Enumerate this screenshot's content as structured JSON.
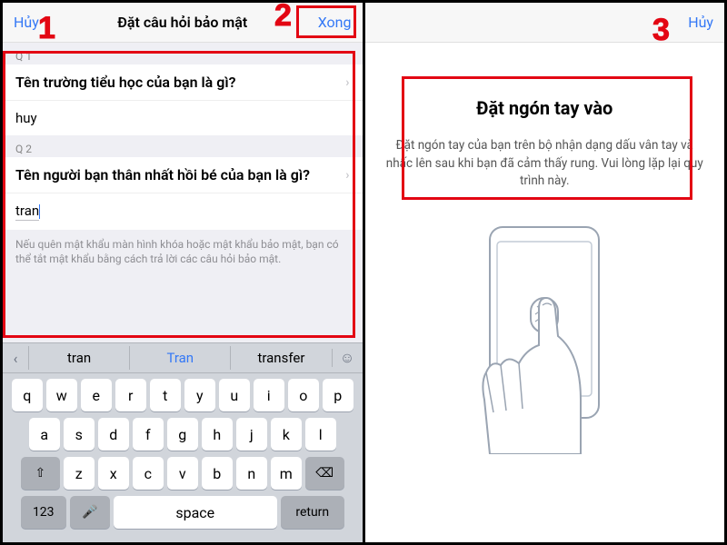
{
  "badges": {
    "n1": "1",
    "n2": "2",
    "n3": "3"
  },
  "left": {
    "nav": {
      "cancel": "Hủy",
      "title": "Đặt câu hỏi bảo mật",
      "done": "Xong"
    },
    "q1": {
      "label": "Q 1",
      "question": "Tên trường tiểu học của bạn là gì?",
      "answer": "huy"
    },
    "q2": {
      "label": "Q 2",
      "question": "Tên người bạn thân nhất hồi bé của bạn là gì?",
      "answer": "tran"
    },
    "hint": "Nếu quên mật khẩu màn hình khóa hoặc mật khẩu bảo mật, bạn có thể tắt mật khẩu bằng cách trả lời các câu hỏi bảo mật.",
    "suggest": {
      "opt1": "tran",
      "opt2": "Tran",
      "opt3": "transfer"
    },
    "keys": {
      "r1": [
        "q",
        "w",
        "e",
        "r",
        "t",
        "y",
        "u",
        "i",
        "o",
        "p"
      ],
      "r2": [
        "a",
        "s",
        "d",
        "f",
        "g",
        "h",
        "j",
        "k",
        "l"
      ],
      "r3": [
        "z",
        "x",
        "c",
        "v",
        "b",
        "n",
        "m"
      ],
      "num": "123",
      "space": "space",
      "ret": "return",
      "shift": "⇧",
      "bksp": "⌫",
      "mic": "🎤",
      "sug_chev": "‹",
      "smile": "☺"
    }
  },
  "right": {
    "nav": {
      "cancel": "Hủy"
    },
    "title": "Đặt ngón tay vào",
    "desc": "Đặt ngón tay của bạn trên bộ nhận dạng dấu vân tay và nhấc lên sau khi bạn đã cảm thấy rung. Vui lòng lặp lại quy trình này."
  }
}
